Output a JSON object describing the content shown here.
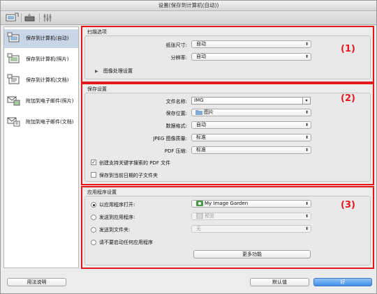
{
  "window": {
    "title": "设置(保存到计算机(自动))"
  },
  "toolbar": {
    "icons": [
      "scan-from-computer-icon",
      "scan-from-panel-icon",
      "general-settings-icon"
    ]
  },
  "sidebar": {
    "items": [
      {
        "label": "保存到计算机(自动)",
        "icon": "computer-auto-icon",
        "selected": true
      },
      {
        "label": "保存到计算机(照片)",
        "icon": "computer-photo-icon",
        "selected": false
      },
      {
        "label": "保存到计算机(文档)",
        "icon": "computer-document-icon",
        "selected": false
      },
      {
        "label": "附加到电子邮件(照片)",
        "icon": "email-photo-icon",
        "selected": false
      },
      {
        "label": "附加到电子邮件(文档)",
        "icon": "email-document-icon",
        "selected": false
      }
    ]
  },
  "scan_options": {
    "title": "扫描选项",
    "marker": "(1)",
    "paper_size_label": "纸张尺寸:",
    "paper_size_value": "自动",
    "resolution_label": "分辨率:",
    "resolution_value": "自动",
    "image_processing_label": "图像处理设置"
  },
  "save_settings": {
    "title": "保存设置",
    "marker": "(2)",
    "file_name_label": "文件名称:",
    "file_name_value": "IMG",
    "save_in_label": "保存位置:",
    "save_in_value": "图片",
    "data_format_label": "数据格式:",
    "data_format_value": "自动",
    "jpeg_quality_label": "JPEG 图像质量:",
    "jpeg_quality_value": "标准",
    "pdf_compression_label": "PDF 压缩:",
    "pdf_compression_value": "标准",
    "keyword_pdf_label": "创建支持关键字搜索的 PDF 文件",
    "keyword_pdf_checked": true,
    "subfolder_label": "保存到当前日期的子文件夹",
    "subfolder_checked": false
  },
  "app_settings": {
    "title": "应用程序设置",
    "marker": "(3)",
    "open_with_label": "以应用程序打开:",
    "open_with_value": "My Image Garden",
    "send_to_app_label": "发送到应用程序:",
    "send_to_app_value": "预览",
    "send_to_folder_label": "发送到文件夹:",
    "send_to_folder_value": "无",
    "no_app_label": "请不要启动任何应用程序",
    "more_functions_label": "更多功能"
  },
  "footer": {
    "instructions_label": "用法说明",
    "defaults_label": "默认值",
    "ok_label": "好"
  },
  "colors": {
    "marker_red": "#e5161c",
    "selection_blue": "#c9d6e8",
    "primary_button": "#3f8ee8"
  }
}
